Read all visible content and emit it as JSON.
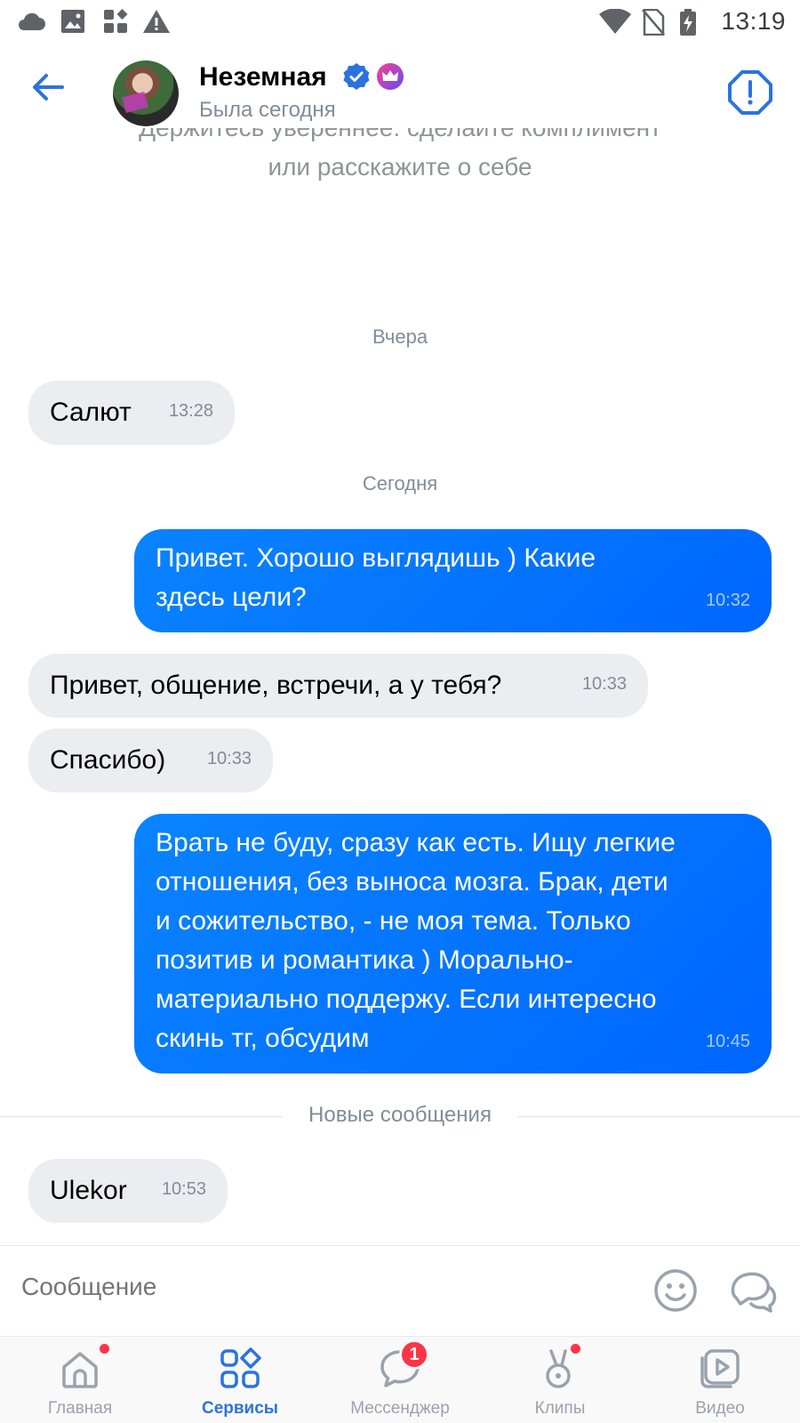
{
  "status_bar": {
    "time": "13:19",
    "icons": [
      "cloud-icon",
      "image-icon",
      "apps-icon",
      "warning-icon",
      "wifi-icon",
      "no-sim-icon",
      "battery-icon"
    ]
  },
  "header": {
    "contact_name": "Неземная",
    "contact_status": "Была сегодня",
    "icons": [
      "back-arrow-icon",
      "verified-badge-icon",
      "crown-premium-icon",
      "report-icon"
    ]
  },
  "chat": {
    "hint_cut": "Держитесь увереннее: сделайте комплимент",
    "hint_line": "или расскажите о себе",
    "date_yesterday": "Вчера",
    "date_today": "Сегодня",
    "new_messages_label": "Новые сообщения",
    "messages": [
      {
        "direction": "in",
        "text": "Салют",
        "time": "13:28"
      },
      {
        "direction": "out",
        "text": "Привет. Хорошо выглядишь ) Какие здесь цели?",
        "lines": [
          "Привет. Хорошо выглядишь ) Какие",
          "здесь цели?"
        ],
        "time": "10:32"
      },
      {
        "direction": "in",
        "text": "Привет, общение, встречи, а у тебя?",
        "time": "10:33"
      },
      {
        "direction": "in",
        "text": "Спасибо)",
        "time": "10:33"
      },
      {
        "direction": "out",
        "text": "Врать не буду, сразу как есть. Ищу легкие отношения, без выноса мозга. Брак, дети и сожительство, - не моя тема. Только позитив и романтика ) Морально-материально поддержу. Если интересно скинь тг, обсудим",
        "lines": [
          "Врать не буду, сразу как есть. Ищу легкие",
          "отношения, без выноса мозга. Брак, дети",
          "и сожительство, - не моя тема. Только",
          "позитив и романтика ) Морально-",
          "материально поддержу. Если интересно",
          "скинь тг, обсудим"
        ],
        "time": "10:45"
      },
      {
        "direction": "in",
        "text": "Ulekor",
        "time": "10:53"
      }
    ]
  },
  "composer": {
    "placeholder": "Сообщение",
    "icons": [
      "emoji-icon",
      "stickers-icon"
    ]
  },
  "tabbar": {
    "tabs": [
      {
        "label": "Главная",
        "icon": "home-icon",
        "active": false,
        "dot": true
      },
      {
        "label": "Сервисы",
        "icon": "services-icon",
        "active": true,
        "dot": false
      },
      {
        "label": "Мессенджер",
        "icon": "messenger-icon",
        "active": false,
        "badge": "1"
      },
      {
        "label": "Клипы",
        "icon": "clips-icon",
        "active": false,
        "dot": true
      },
      {
        "label": "Видео",
        "icon": "video-icon",
        "active": false,
        "dot": false
      }
    ]
  },
  "colors": {
    "accent": "#2b72e0",
    "outgoing_bubble": "#0a84ff",
    "incoming_bubble": "#ebedf0",
    "secondary_text": "#818c99",
    "notification": "#ff3347"
  }
}
